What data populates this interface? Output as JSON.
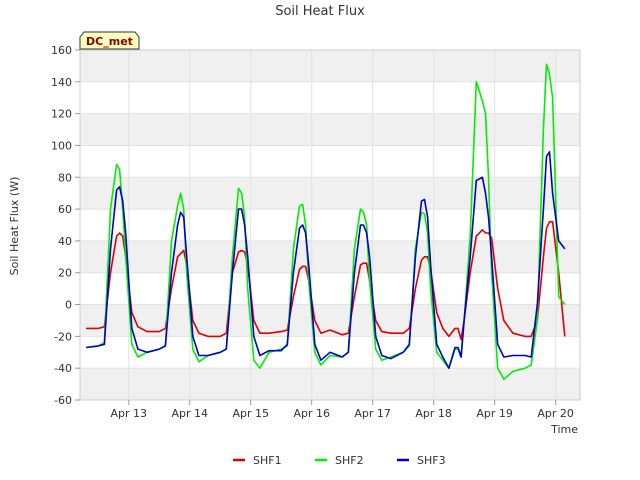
{
  "chart_data": {
    "type": "line",
    "title": "Soil Heat Flux",
    "xlabel": "Time",
    "ylabel": "Soil Heat Flux (W)",
    "badge": "DC_met",
    "xlim": [
      12.2,
      20.4
    ],
    "ylim": [
      -60,
      160
    ],
    "yticks": [
      -60,
      -40,
      -20,
      0,
      20,
      40,
      60,
      80,
      100,
      120,
      140,
      160
    ],
    "xticks": [
      {
        "value": 12,
        "label": "Apr 12"
      },
      {
        "value": 13,
        "label": "Apr 13"
      },
      {
        "value": 14,
        "label": "Apr 14"
      },
      {
        "value": 15,
        "label": "Apr 15"
      },
      {
        "value": 16,
        "label": "Apr 16"
      },
      {
        "value": 17,
        "label": "Apr 17"
      },
      {
        "value": 18,
        "label": "Apr 18"
      },
      {
        "value": 19,
        "label": "Apr 19"
      },
      {
        "value": 20,
        "label": "Apr 20"
      }
    ],
    "grid": true,
    "legend_position": "bottom",
    "series": [
      {
        "name": "SHF1",
        "color": "#e00000",
        "x": [
          12.3,
          12.5,
          12.6,
          12.7,
          12.8,
          12.85,
          12.9,
          12.95,
          13.05,
          13.15,
          13.3,
          13.5,
          13.6,
          13.7,
          13.8,
          13.85,
          13.9,
          13.95,
          14.05,
          14.15,
          14.3,
          14.5,
          14.6,
          14.7,
          14.8,
          14.85,
          14.9,
          14.95,
          15.05,
          15.15,
          15.3,
          15.5,
          15.6,
          15.7,
          15.8,
          15.85,
          15.9,
          15.95,
          16.05,
          16.15,
          16.3,
          16.5,
          16.6,
          16.7,
          16.8,
          16.85,
          16.9,
          16.95,
          17.05,
          17.15,
          17.3,
          17.5,
          17.6,
          17.7,
          17.8,
          17.85,
          17.9,
          17.95,
          18.05,
          18.15,
          18.25,
          18.35,
          18.4,
          18.45,
          18.5,
          18.6,
          18.7,
          18.8,
          18.85,
          18.9,
          18.95,
          19.05,
          19.15,
          19.3,
          19.5,
          19.6,
          19.7,
          19.8,
          19.85,
          19.9,
          19.95,
          20.05,
          20.15
        ],
        "y": [
          -15,
          -15,
          -14,
          20,
          43,
          45,
          43,
          30,
          -5,
          -14,
          -17,
          -17,
          -15,
          10,
          30,
          32,
          34,
          25,
          -10,
          -18,
          -20,
          -20,
          -18,
          20,
          33,
          34,
          33,
          25,
          -10,
          -18,
          -18,
          -17,
          -16,
          5,
          22,
          24,
          24,
          15,
          -10,
          -18,
          -16,
          -19,
          -18,
          5,
          25,
          26,
          26,
          15,
          -10,
          -17,
          -18,
          -18,
          -15,
          10,
          28,
          30,
          30,
          22,
          -5,
          -15,
          -20,
          -15,
          -15,
          -22,
          -10,
          20,
          43,
          47,
          45,
          45,
          42,
          10,
          -10,
          -18,
          -20,
          -20,
          -10,
          30,
          48,
          52,
          52,
          20,
          -20
        ]
      },
      {
        "name": "SHF2",
        "color": "#00ee00",
        "x": [
          12.3,
          12.5,
          12.6,
          12.7,
          12.8,
          12.85,
          12.9,
          12.95,
          13.05,
          13.15,
          13.3,
          13.5,
          13.6,
          13.7,
          13.8,
          13.85,
          13.9,
          13.95,
          14.05,
          14.15,
          14.3,
          14.5,
          14.6,
          14.7,
          14.8,
          14.85,
          14.9,
          14.95,
          15.05,
          15.15,
          15.3,
          15.5,
          15.6,
          15.7,
          15.8,
          15.85,
          15.9,
          15.95,
          16.05,
          16.15,
          16.3,
          16.5,
          16.6,
          16.7,
          16.8,
          16.85,
          16.9,
          16.95,
          17.05,
          17.15,
          17.3,
          17.5,
          17.6,
          17.7,
          17.8,
          17.85,
          17.9,
          17.95,
          18.05,
          18.15,
          18.25,
          18.35,
          18.4,
          18.45,
          18.5,
          18.6,
          18.7,
          18.8,
          18.85,
          18.9,
          18.95,
          19.05,
          19.15,
          19.3,
          19.5,
          19.6,
          19.7,
          19.8,
          19.85,
          19.9,
          19.95,
          20.05,
          20.15
        ],
        "y": [
          -27,
          -26,
          -24,
          60,
          88,
          85,
          60,
          30,
          -25,
          -33,
          -30,
          -28,
          -26,
          40,
          62,
          70,
          60,
          20,
          -28,
          -36,
          -32,
          -30,
          -28,
          30,
          73,
          70,
          55,
          10,
          -35,
          -40,
          -30,
          -28,
          -26,
          35,
          62,
          63,
          50,
          15,
          -30,
          -38,
          -32,
          -33,
          -30,
          35,
          60,
          58,
          50,
          15,
          -28,
          -35,
          -33,
          -30,
          -26,
          35,
          58,
          57,
          45,
          10,
          -30,
          -35,
          -40,
          -28,
          -28,
          -33,
          -10,
          43,
          140,
          128,
          120,
          80,
          20,
          -40,
          -47,
          -42,
          -40,
          -38,
          -10,
          110,
          151,
          145,
          130,
          5,
          0
        ]
      },
      {
        "name": "SHF3",
        "color": "#0000cc",
        "x": [
          12.3,
          12.5,
          12.6,
          12.7,
          12.8,
          12.85,
          12.9,
          12.95,
          13.05,
          13.15,
          13.3,
          13.5,
          13.6,
          13.7,
          13.8,
          13.85,
          13.9,
          13.95,
          14.05,
          14.15,
          14.3,
          14.5,
          14.6,
          14.7,
          14.8,
          14.85,
          14.9,
          14.95,
          15.05,
          15.15,
          15.3,
          15.5,
          15.6,
          15.7,
          15.8,
          15.85,
          15.9,
          15.95,
          16.05,
          16.15,
          16.3,
          16.5,
          16.6,
          16.7,
          16.8,
          16.85,
          16.9,
          16.95,
          17.05,
          17.15,
          17.3,
          17.5,
          17.6,
          17.7,
          17.8,
          17.85,
          17.9,
          17.95,
          18.05,
          18.15,
          18.25,
          18.35,
          18.4,
          18.45,
          18.5,
          18.6,
          18.7,
          18.8,
          18.85,
          18.9,
          18.95,
          19.05,
          19.15,
          19.3,
          19.5,
          19.6,
          19.7,
          19.8,
          19.85,
          19.9,
          19.95,
          20.05,
          20.15
        ],
        "y": [
          -27,
          -26,
          -25,
          35,
          72,
          74,
          65,
          45,
          -15,
          -28,
          -30,
          -28,
          -26,
          20,
          50,
          58,
          55,
          30,
          -20,
          -32,
          -32,
          -30,
          -28,
          20,
          60,
          60,
          50,
          30,
          -20,
          -32,
          -29,
          -29,
          -25,
          20,
          48,
          50,
          45,
          25,
          -25,
          -35,
          -30,
          -33,
          -30,
          20,
          50,
          50,
          45,
          30,
          -20,
          -32,
          -34,
          -30,
          -25,
          30,
          65,
          66,
          55,
          25,
          -25,
          -33,
          -40,
          -27,
          -27,
          -33,
          -10,
          30,
          78,
          80,
          70,
          55,
          30,
          -25,
          -33,
          -32,
          -32,
          -33,
          0,
          60,
          93,
          96,
          70,
          40,
          35
        ]
      }
    ]
  }
}
